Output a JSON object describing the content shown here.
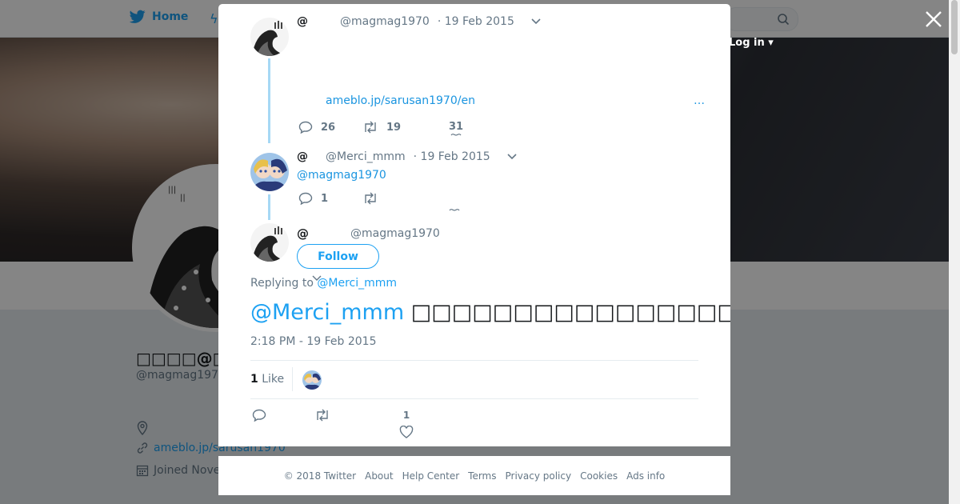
{
  "topbar": {
    "home_label": "Home",
    "login_label": "Log in"
  },
  "profile": {
    "name": "□□□□@□□□",
    "handle": "@magmag197",
    "website": "ameblo.jp/sarusan1970",
    "joined": "Joined Nove"
  },
  "thread": [
    {
      "name": "@",
      "handle": "@magmag1970",
      "date": "· 19 Feb 2015",
      "link": "ameblo.jp/sarusan1970/en",
      "ellipsis": "…",
      "replies": "26",
      "retweets": "19",
      "likes": "31"
    },
    {
      "name": "@",
      "handle": "@Merci_mmm",
      "date": "· 19 Feb 2015",
      "mention": "@magmag1970",
      "replies": "1"
    }
  ],
  "main_tweet": {
    "name": "@",
    "handle": "@magmag1970",
    "follow_label": "Follow",
    "replying_prefix": "Replying to",
    "replying_user": "@Merci_mmm",
    "mention": "@Merci_mmm",
    "text": "□□□□□□□□□□□□□□□□□□□□□□□□□□□□□□□□□□□□□□",
    "timestamp": "2:18 PM - 19 Feb 2015",
    "like_count": "1",
    "like_label": "Like",
    "action_like_count": "1"
  },
  "footer": {
    "links": [
      "© 2018 Twitter",
      "About",
      "Help Center",
      "Terms",
      "Privacy policy",
      "Cookies",
      "Ads info"
    ]
  },
  "colors": {
    "accent": "#1da1f2",
    "thread_line": "#a6d8f5",
    "text_secondary": "#657786"
  },
  "icons": [
    "twitter-bird-icon",
    "search-icon",
    "close-icon",
    "chevron-down-icon",
    "reply-icon",
    "retweet-icon",
    "heart-icon",
    "location-icon",
    "link-icon",
    "calendar-icon"
  ]
}
